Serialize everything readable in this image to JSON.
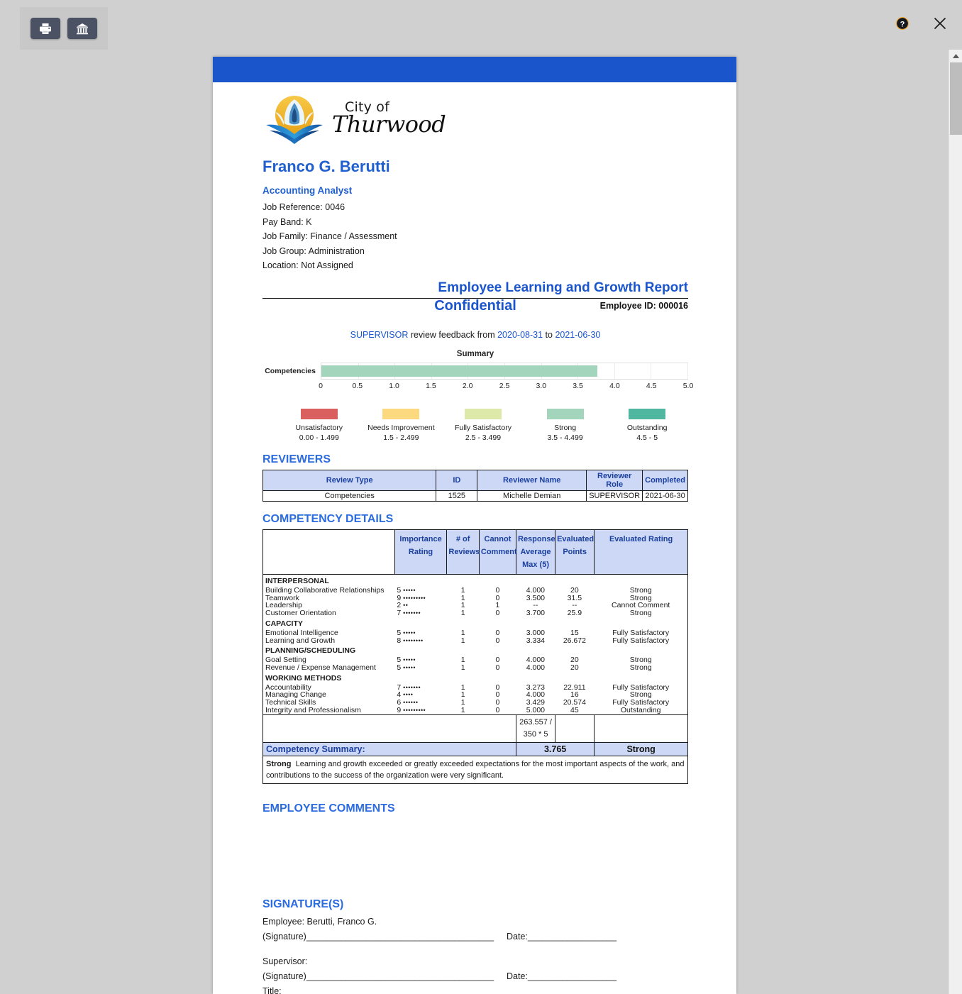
{
  "toolbar": {
    "print_label": "Print",
    "archive_label": "Archive",
    "help_label": "Help",
    "close_label": "Close"
  },
  "letterhead": {
    "city_line": "City of",
    "org_name": "Thurwood"
  },
  "employee": {
    "name": "Franco G. Berutti",
    "title": "Accounting Analyst",
    "job_reference": "Job Reference: 0046",
    "pay_band": "Pay Band: K",
    "job_family": "Job Family: Finance / Assessment",
    "job_group": "Job Group: Administration",
    "location": "Location: Not Assigned",
    "employee_id": "Employee ID: 000016"
  },
  "report": {
    "title": "Employee Learning and Growth Report",
    "confidential": "Confidential",
    "review_prefix": "SUPERVISOR",
    "review_mid": " review feedback from ",
    "review_from": "2020-08-31",
    "review_to_sep": " to ",
    "review_to": "2021-06-30"
  },
  "chart_data": {
    "type": "bar",
    "title": "Summary",
    "orientation": "horizontal",
    "categories": [
      "Competencies"
    ],
    "values": [
      3.765
    ],
    "xlabel": "",
    "ylabel": "",
    "xlim": [
      0,
      5
    ],
    "ticks": [
      "0",
      "0.5",
      "1.0",
      "1.5",
      "2.0",
      "2.5",
      "3.0",
      "3.5",
      "4.0",
      "4.5",
      "5.0"
    ],
    "tick_values": [
      0,
      0.5,
      1,
      1.5,
      2,
      2.5,
      3,
      3.5,
      4,
      4.5,
      5
    ],
    "bar_color": "#a3d5bc",
    "grid": true,
    "legend_position": "bottom",
    "legend": [
      {
        "label": "Unsatisfactory",
        "range": "0.00 - 1.499",
        "color": "#d9605f"
      },
      {
        "label": "Needs Improvement",
        "range": "1.5 - 2.499",
        "color": "#fcd97e"
      },
      {
        "label": "Fully Satisfactory",
        "range": "2.5 - 3.499",
        "color": "#dce9a8"
      },
      {
        "label": "Strong",
        "range": "3.5 - 4.499",
        "color": "#a3d5bc"
      },
      {
        "label": "Outstanding",
        "range": "4.5 - 5",
        "color": "#4fb79f"
      }
    ]
  },
  "reviewers": {
    "heading": "REVIEWERS",
    "columns": [
      "Review Type",
      "ID",
      "Reviewer Name",
      "Reviewer Role",
      "Completed"
    ],
    "rows": [
      {
        "review_type": "Competencies",
        "id": "1525",
        "name": "Michelle Demian",
        "role": "SUPERVISOR",
        "completed": "2021-06-30"
      }
    ]
  },
  "competency": {
    "heading": "COMPETENCY DETAILS",
    "columns": {
      "blank": "",
      "importance": "Importance Rating",
      "importance_l1": "Importance",
      "importance_l2": "Rating",
      "reviews_l1": "# of",
      "reviews_l2": "Reviews",
      "cannot_l1": "Cannot",
      "cannot_l2": "Comment",
      "response_l1": "Response",
      "response_l2": "Average",
      "response_l3": "Max (5)",
      "points_l1": "Evaluated",
      "points_l2": "Points",
      "rating": "Evaluated Rating"
    },
    "groups": [
      {
        "name": "INTERPERSONAL",
        "items": [
          {
            "name": "Building Collaborative Relationships",
            "importance": "5",
            "dots": "•••••",
            "reviews": "1",
            "cannot": "0",
            "response": "4.000",
            "points": "20",
            "rating": "Strong"
          },
          {
            "name": "Teamwork",
            "importance": "9",
            "dots": "•••••••••",
            "reviews": "1",
            "cannot": "0",
            "response": "3.500",
            "points": "31.5",
            "rating": "Strong"
          },
          {
            "name": "Leadership",
            "importance": "2",
            "dots": "••",
            "reviews": "1",
            "cannot": "1",
            "response": "--",
            "points": "--",
            "rating": "Cannot Comment"
          },
          {
            "name": "Customer Orientation",
            "importance": "7",
            "dots": "•••••••",
            "reviews": "1",
            "cannot": "0",
            "response": "3.700",
            "points": "25.9",
            "rating": "Strong"
          }
        ]
      },
      {
        "name": "CAPACITY",
        "items": [
          {
            "name": "Emotional Intelligence",
            "importance": "5",
            "dots": "•••••",
            "reviews": "1",
            "cannot": "0",
            "response": "3.000",
            "points": "15",
            "rating": "Fully Satisfactory"
          },
          {
            "name": "Learning and Growth",
            "importance": "8",
            "dots": "••••••••",
            "reviews": "1",
            "cannot": "0",
            "response": "3.334",
            "points": "26.672",
            "rating": "Fully Satisfactory"
          }
        ]
      },
      {
        "name": "PLANNING/SCHEDULING",
        "items": [
          {
            "name": "Goal Setting",
            "importance": "5",
            "dots": "•••••",
            "reviews": "1",
            "cannot": "0",
            "response": "4.000",
            "points": "20",
            "rating": "Strong"
          },
          {
            "name": "Revenue / Expense Management",
            "importance": "5",
            "dots": "•••••",
            "reviews": "1",
            "cannot": "0",
            "response": "4.000",
            "points": "20",
            "rating": "Strong"
          }
        ]
      },
      {
        "name": "WORKING METHODS",
        "items": [
          {
            "name": "Accountability",
            "importance": "7",
            "dots": "•••••••",
            "reviews": "1",
            "cannot": "0",
            "response": "3.273",
            "points": "22.911",
            "rating": "Fully Satisfactory"
          },
          {
            "name": "Managing Change",
            "importance": "4",
            "dots": "••••",
            "reviews": "1",
            "cannot": "0",
            "response": "4.000",
            "points": "16",
            "rating": "Strong"
          },
          {
            "name": "Technical Skills",
            "importance": "6",
            "dots": "••••••",
            "reviews": "1",
            "cannot": "0",
            "response": "3.429",
            "points": "20.574",
            "rating": "Fully Satisfactory"
          },
          {
            "name": "Integrity and Professionalism",
            "importance": "9",
            "dots": "•••••••••",
            "reviews": "1",
            "cannot": "0",
            "response": "5.000",
            "points": "45",
            "rating": "Outstanding"
          }
        ]
      }
    ],
    "calc_numerator": "263.557 /",
    "calc_denominator": "350 * 5",
    "summary_label": "Competency Summary:",
    "summary_value": "3.765",
    "summary_rating": "Strong",
    "description_term": "Strong",
    "description_text": "Learning and growth exceeded or greatly exceeded expectations for the most important aspects of the work, and contributions to the success of the organization were very significant."
  },
  "comments": {
    "heading": "EMPLOYEE COMMENTS",
    "body": ""
  },
  "signatures": {
    "heading": "SIGNATURE(S)",
    "employee_line": "Employee: Berutti, Franco G.",
    "signature_label": "(Signature) ",
    "signature_rule": "______________________________________",
    "date_label": "Date: ",
    "date_rule": "__________________",
    "supervisor_line": "Supervisor:",
    "title_line": "Title:"
  }
}
